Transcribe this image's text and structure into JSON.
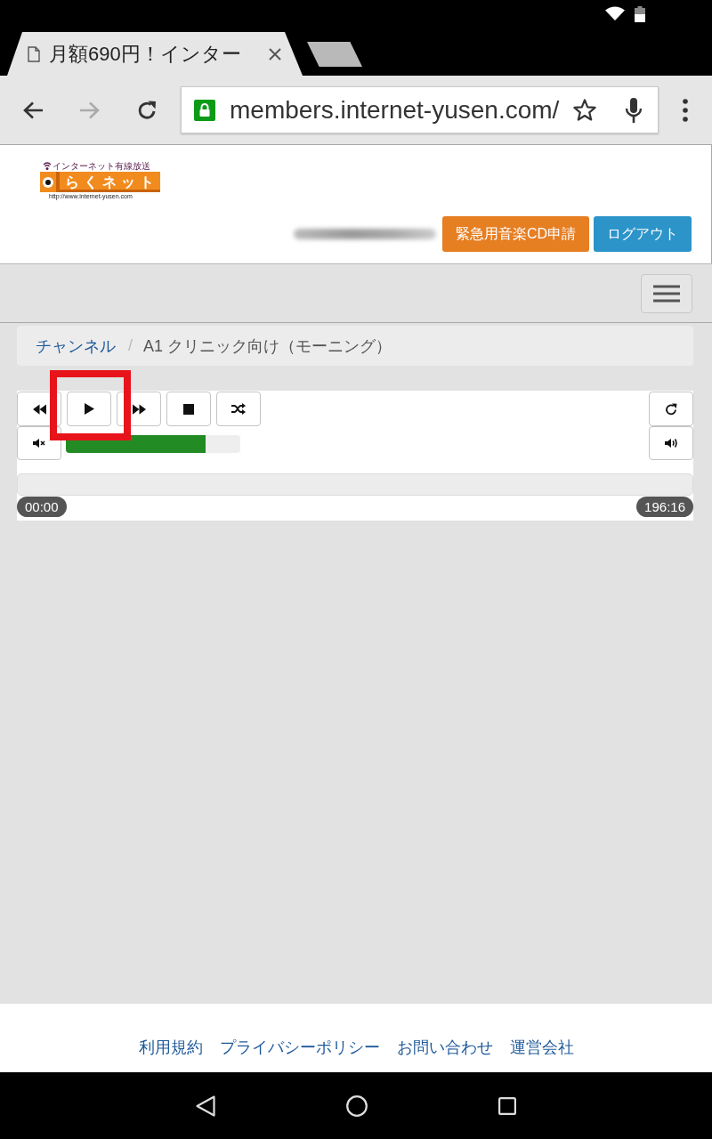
{
  "browser": {
    "tab": {
      "title": "月額690円！インター"
    },
    "url": "members.internet-yusen.com/"
  },
  "header": {
    "logo": {
      "tagline": "インターネット有線放送",
      "name": "らくネット",
      "url": "http://www.internet-yusen.com"
    },
    "buttons": [
      {
        "label": "緊急用音楽CD申請",
        "kind": "request"
      },
      {
        "label": "ログアウト",
        "kind": "logout"
      }
    ]
  },
  "breadcrumb": {
    "items": [
      {
        "label": "チャンネル",
        "kind": "link"
      },
      {
        "label": "A1 クリニック向け（モーニング）",
        "kind": "current"
      }
    ],
    "separator": "/"
  },
  "player": {
    "transport": [
      {
        "kind": "rewind",
        "highlighted": false
      },
      {
        "kind": "play",
        "highlighted": true
      },
      {
        "kind": "forward",
        "highlighted": false
      },
      {
        "kind": "stop",
        "highlighted": false
      },
      {
        "kind": "shuffle",
        "highlighted": false
      }
    ],
    "refresh": [
      {
        "kind": "reload",
        "highlighted": false
      }
    ],
    "volume": {
      "mute": {
        "kind": "mute",
        "highlighted": false
      },
      "level": 0.8,
      "louder": {
        "kind": "volume_up",
        "highlighted": false
      }
    },
    "progress": {
      "level": 0,
      "elapsed": "00:00",
      "total": "196:16"
    }
  },
  "footer": {
    "links": [
      "利用規約",
      "プライバシーポリシー",
      "お問い合わせ",
      "運営会社"
    ]
  }
}
